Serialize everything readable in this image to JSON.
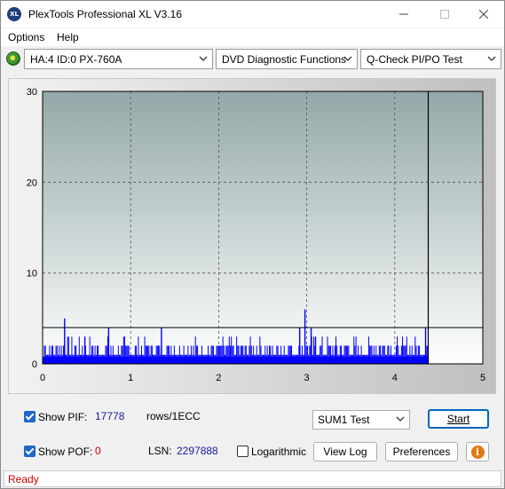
{
  "window": {
    "title": "PlexTools Professional XL V3.16",
    "app_icon_text": "XL"
  },
  "menu": {
    "options": "Options",
    "help": "Help"
  },
  "toolbar": {
    "drive": "HA:4 ID:0  PX-760A",
    "function": "DVD Diagnostic Functions",
    "test": "Q-Check PI/PO Test"
  },
  "chart_data": {
    "type": "bar",
    "x_ticks": [
      "0",
      "1",
      "2",
      "3",
      "4",
      "5"
    ],
    "y_ticks": [
      "0",
      "10",
      "20",
      "30"
    ],
    "xlim": [
      0,
      5
    ],
    "ylim": [
      0,
      30
    ],
    "grid": true,
    "threshold": 4,
    "scan_end_x": 4.38,
    "baseline": 0.8,
    "spikes": [
      {
        "x": 0.25,
        "y": 5
      },
      {
        "x": 0.48,
        "y": 3
      },
      {
        "x": 0.75,
        "y": 4
      },
      {
        "x": 1.35,
        "y": 4
      },
      {
        "x": 2.92,
        "y": 4
      },
      {
        "x": 2.98,
        "y": 6
      },
      {
        "x": 3.05,
        "y": 4
      },
      {
        "x": 3.1,
        "y": 3
      },
      {
        "x": 4.35,
        "y": 4
      }
    ]
  },
  "controls": {
    "show_pif_label": "Show PIF:",
    "pif_value": "17778",
    "pif_unit": "rows/1ECC",
    "show_pof_label": "Show POF:",
    "pof_value": "0",
    "lsn_label": "LSN:",
    "lsn_value": "2297888",
    "logarithmic_label": "Logarithmic",
    "sum_select": "SUM1 Test",
    "start": "Start",
    "view_log": "View Log",
    "preferences": "Preferences",
    "info_glyph": "i"
  },
  "status": {
    "text": "Ready",
    "color": "#d00000"
  },
  "colors": {
    "bars": "#0000ff",
    "plot_top": "#93a8a8",
    "plot_bottom": "#ffffff"
  }
}
